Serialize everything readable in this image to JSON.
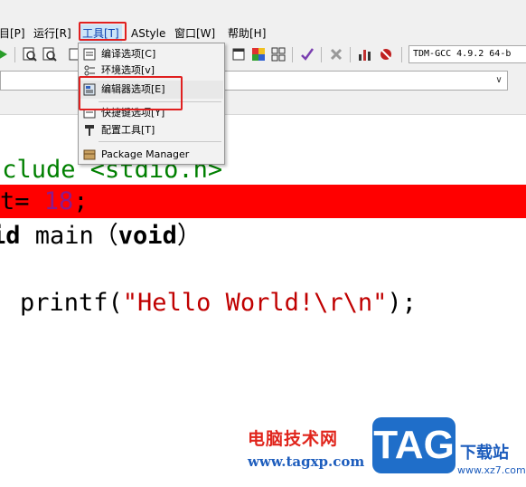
{
  "menubar": {
    "items": [
      {
        "label": "目[P]"
      },
      {
        "label": "运行[R]"
      },
      {
        "label": "工具[T]"
      },
      {
        "label": "AStyle"
      },
      {
        "label": "窗口[W]"
      },
      {
        "label": "帮助[H]"
      }
    ],
    "active_index": 2
  },
  "toolbar": {
    "compiler": "TDM-GCC 4.9.2 64-b"
  },
  "tools_menu": {
    "items": [
      {
        "label": "编译选项[C]",
        "icon": "compiler-options-icon"
      },
      {
        "label": "环境选项[v]",
        "icon": "environment-options-icon"
      },
      {
        "label": "编辑器选项[E]",
        "icon": "editor-options-icon"
      },
      {
        "label": "快捷键选项[Y]",
        "icon": "shortcut-options-icon"
      },
      {
        "label": "配置工具[T]",
        "icon": "configure-tools-icon"
      },
      {
        "label": "Package Manager",
        "icon": "package-manager-icon"
      }
    ],
    "highlighted_index": 2
  },
  "editor": {
    "lines": [
      {
        "text_a": "nclude ",
        "text_b": "<stdio.h>"
      },
      {
        "text_a": "t= ",
        "num": "18",
        "text_b": ";"
      },
      {
        "kw": "id",
        "mid": " main（",
        "kw2": "void",
        "end": "）"
      },
      {
        "pre": "printf(",
        "str": "\"Hello World!\\r\\n\"",
        "post": ");"
      }
    ]
  },
  "watermark": {
    "cn": "电脑技术网",
    "url": "www.tagxp.com",
    "tag": "TAG",
    "site_cn": "下载站",
    "site_url": "www.xz7.com"
  },
  "colors": {
    "highlight_box": "#e02020",
    "error_line": "#ff0000",
    "preprocessor": "#008000",
    "string": "#c00000",
    "number": "#8b1a8b"
  }
}
